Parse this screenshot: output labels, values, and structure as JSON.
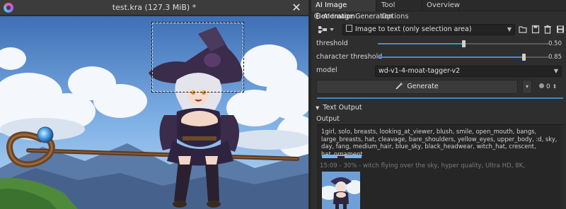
{
  "window": {
    "title": "test.kra (127.3 MiB) *",
    "close_symbol": "✕"
  },
  "tabs": [
    {
      "label": "AI Image Generation"
    },
    {
      "label": "Tool Options"
    },
    {
      "label": "Overview"
    }
  ],
  "panel": {
    "header": "AI Image Generation",
    "workspace_value": "Image to text (only selection area)",
    "toolbar_icons": [
      "folder-icon",
      "save-icon",
      "trash-icon",
      "disk-icon"
    ]
  },
  "sliders": {
    "threshold": {
      "label": "threshold",
      "value": "0.50",
      "fraction": 0.5
    },
    "character_threshold": {
      "label": "character threshold",
      "value": "0.85",
      "fraction": 0.85
    }
  },
  "model": {
    "label": "model",
    "value": "wd-v1-4-moat-tagger-v2"
  },
  "generate": {
    "label": "Generate",
    "seed_value": "0",
    "dropdown_symbol": "▾",
    "seed_spin_symbol": "⬍"
  },
  "section": {
    "title": "Text Output",
    "output_label": "Output",
    "output_text": "1girl, solo, breasts, looking_at_viewer, blush, smile, open_mouth, bangs, large_breasts, hat, cleavage, bare_shoulders, yellow_eyes, upper_body, :d, sky, day, fang, medium_hair, blue_sky, black_headwear, witch_hat, crescent, hat_ornament",
    "history_caption": "15:09 - 30% - witch flying over the sky, hyper quality, Ultra HD, 8K,"
  },
  "colors": {
    "accent": "#4a8acb",
    "progress": "#3d87c9",
    "panel_bg": "#2e2e2e"
  }
}
